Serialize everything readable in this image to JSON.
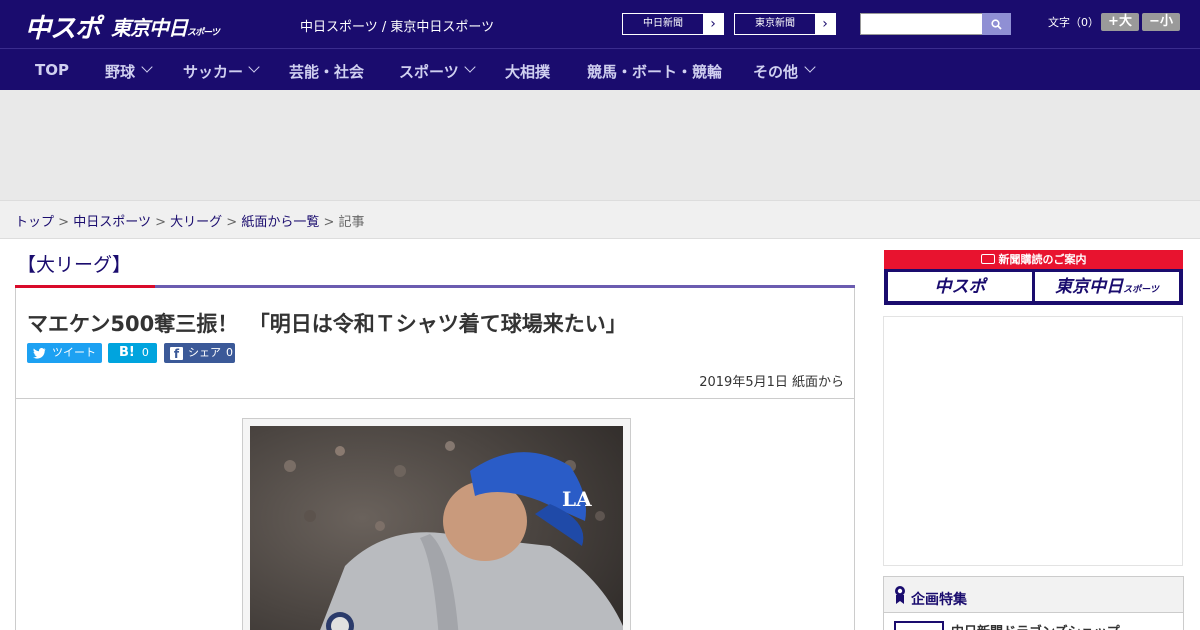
{
  "header": {
    "logo_main": "中スポ",
    "logo_tokyo": "東京中日",
    "logo_tokyo_sub": "スポーツ",
    "site_names": "中日スポーツ / 東京中日スポーツ",
    "link_chunichi": "中日新聞",
    "link_tokyo": "東京新聞",
    "font_label": "文字（0）",
    "font_larger": "+大",
    "font_smaller": "−小"
  },
  "nav": {
    "items": [
      "TOP",
      "野球",
      "サッカー",
      "芸能・社会",
      "スポーツ",
      "大相撲",
      "競馬・ボート・競輪",
      "その他"
    ]
  },
  "breadcrumb": {
    "items": [
      "トップ",
      "中日スポーツ",
      "大リーグ",
      "紙面から一覧"
    ],
    "current": "記事",
    "sep": ">"
  },
  "article": {
    "category": "【大リーグ】",
    "headline": "マエケン500奪三振！　「明日は令和Ｔシャツ着て球場来たい」",
    "share_tweet": "ツイート",
    "share_hatena_label": "B!",
    "share_hatena_count": "0",
    "share_fb_label": "シェア",
    "share_fb_count": "0",
    "date": "2019年5月1日 紙面から"
  },
  "sidebar": {
    "subscribe_head": "新聞購読のご案内",
    "subscribe_chuspo": "中スポ",
    "subscribe_tokyo": "東京中日",
    "subscribe_tokyo_sub": "スポーツ",
    "special_title": "企画特集",
    "special_item": "中日新聞ドラゴンズショップ"
  },
  "colors": {
    "brand_navy": "#1a0c6e",
    "accent_red": "#d90b2a",
    "twitter": "#1da1f2",
    "hatena": "#00a4de",
    "facebook": "#3b5998"
  }
}
